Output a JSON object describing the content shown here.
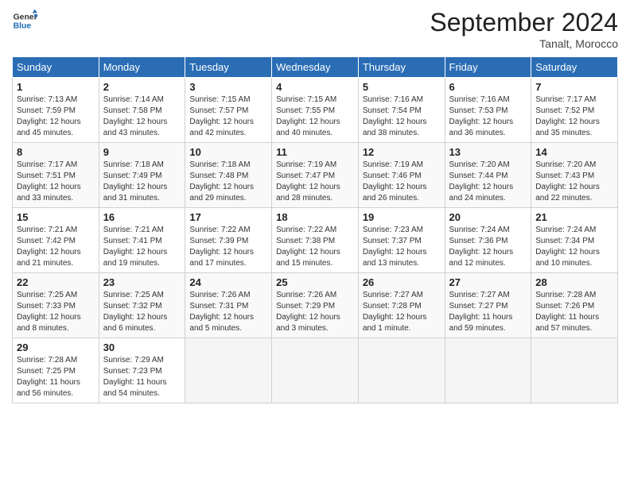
{
  "header": {
    "logo_line1": "General",
    "logo_line2": "Blue",
    "month_title": "September 2024",
    "location": "Tanalt, Morocco"
  },
  "weekdays": [
    "Sunday",
    "Monday",
    "Tuesday",
    "Wednesday",
    "Thursday",
    "Friday",
    "Saturday"
  ],
  "weeks": [
    [
      {
        "day": "1",
        "sunrise": "7:13 AM",
        "sunset": "7:59 PM",
        "daylight": "12 hours and 45 minutes."
      },
      {
        "day": "2",
        "sunrise": "7:14 AM",
        "sunset": "7:58 PM",
        "daylight": "12 hours and 43 minutes."
      },
      {
        "day": "3",
        "sunrise": "7:15 AM",
        "sunset": "7:57 PM",
        "daylight": "12 hours and 42 minutes."
      },
      {
        "day": "4",
        "sunrise": "7:15 AM",
        "sunset": "7:55 PM",
        "daylight": "12 hours and 40 minutes."
      },
      {
        "day": "5",
        "sunrise": "7:16 AM",
        "sunset": "7:54 PM",
        "daylight": "12 hours and 38 minutes."
      },
      {
        "day": "6",
        "sunrise": "7:16 AM",
        "sunset": "7:53 PM",
        "daylight": "12 hours and 36 minutes."
      },
      {
        "day": "7",
        "sunrise": "7:17 AM",
        "sunset": "7:52 PM",
        "daylight": "12 hours and 35 minutes."
      }
    ],
    [
      {
        "day": "8",
        "sunrise": "7:17 AM",
        "sunset": "7:51 PM",
        "daylight": "12 hours and 33 minutes."
      },
      {
        "day": "9",
        "sunrise": "7:18 AM",
        "sunset": "7:49 PM",
        "daylight": "12 hours and 31 minutes."
      },
      {
        "day": "10",
        "sunrise": "7:18 AM",
        "sunset": "7:48 PM",
        "daylight": "12 hours and 29 minutes."
      },
      {
        "day": "11",
        "sunrise": "7:19 AM",
        "sunset": "7:47 PM",
        "daylight": "12 hours and 28 minutes."
      },
      {
        "day": "12",
        "sunrise": "7:19 AM",
        "sunset": "7:46 PM",
        "daylight": "12 hours and 26 minutes."
      },
      {
        "day": "13",
        "sunrise": "7:20 AM",
        "sunset": "7:44 PM",
        "daylight": "12 hours and 24 minutes."
      },
      {
        "day": "14",
        "sunrise": "7:20 AM",
        "sunset": "7:43 PM",
        "daylight": "12 hours and 22 minutes."
      }
    ],
    [
      {
        "day": "15",
        "sunrise": "7:21 AM",
        "sunset": "7:42 PM",
        "daylight": "12 hours and 21 minutes."
      },
      {
        "day": "16",
        "sunrise": "7:21 AM",
        "sunset": "7:41 PM",
        "daylight": "12 hours and 19 minutes."
      },
      {
        "day": "17",
        "sunrise": "7:22 AM",
        "sunset": "7:39 PM",
        "daylight": "12 hours and 17 minutes."
      },
      {
        "day": "18",
        "sunrise": "7:22 AM",
        "sunset": "7:38 PM",
        "daylight": "12 hours and 15 minutes."
      },
      {
        "day": "19",
        "sunrise": "7:23 AM",
        "sunset": "7:37 PM",
        "daylight": "12 hours and 13 minutes."
      },
      {
        "day": "20",
        "sunrise": "7:24 AM",
        "sunset": "7:36 PM",
        "daylight": "12 hours and 12 minutes."
      },
      {
        "day": "21",
        "sunrise": "7:24 AM",
        "sunset": "7:34 PM",
        "daylight": "12 hours and 10 minutes."
      }
    ],
    [
      {
        "day": "22",
        "sunrise": "7:25 AM",
        "sunset": "7:33 PM",
        "daylight": "12 hours and 8 minutes."
      },
      {
        "day": "23",
        "sunrise": "7:25 AM",
        "sunset": "7:32 PM",
        "daylight": "12 hours and 6 minutes."
      },
      {
        "day": "24",
        "sunrise": "7:26 AM",
        "sunset": "7:31 PM",
        "daylight": "12 hours and 5 minutes."
      },
      {
        "day": "25",
        "sunrise": "7:26 AM",
        "sunset": "7:29 PM",
        "daylight": "12 hours and 3 minutes."
      },
      {
        "day": "26",
        "sunrise": "7:27 AM",
        "sunset": "7:28 PM",
        "daylight": "12 hours and 1 minute."
      },
      {
        "day": "27",
        "sunrise": "7:27 AM",
        "sunset": "7:27 PM",
        "daylight": "11 hours and 59 minutes."
      },
      {
        "day": "28",
        "sunrise": "7:28 AM",
        "sunset": "7:26 PM",
        "daylight": "11 hours and 57 minutes."
      }
    ],
    [
      {
        "day": "29",
        "sunrise": "7:28 AM",
        "sunset": "7:25 PM",
        "daylight": "11 hours and 56 minutes."
      },
      {
        "day": "30",
        "sunrise": "7:29 AM",
        "sunset": "7:23 PM",
        "daylight": "11 hours and 54 minutes."
      },
      null,
      null,
      null,
      null,
      null
    ]
  ],
  "labels": {
    "sunrise": "Sunrise:",
    "sunset": "Sunset:",
    "daylight": "Daylight:"
  }
}
